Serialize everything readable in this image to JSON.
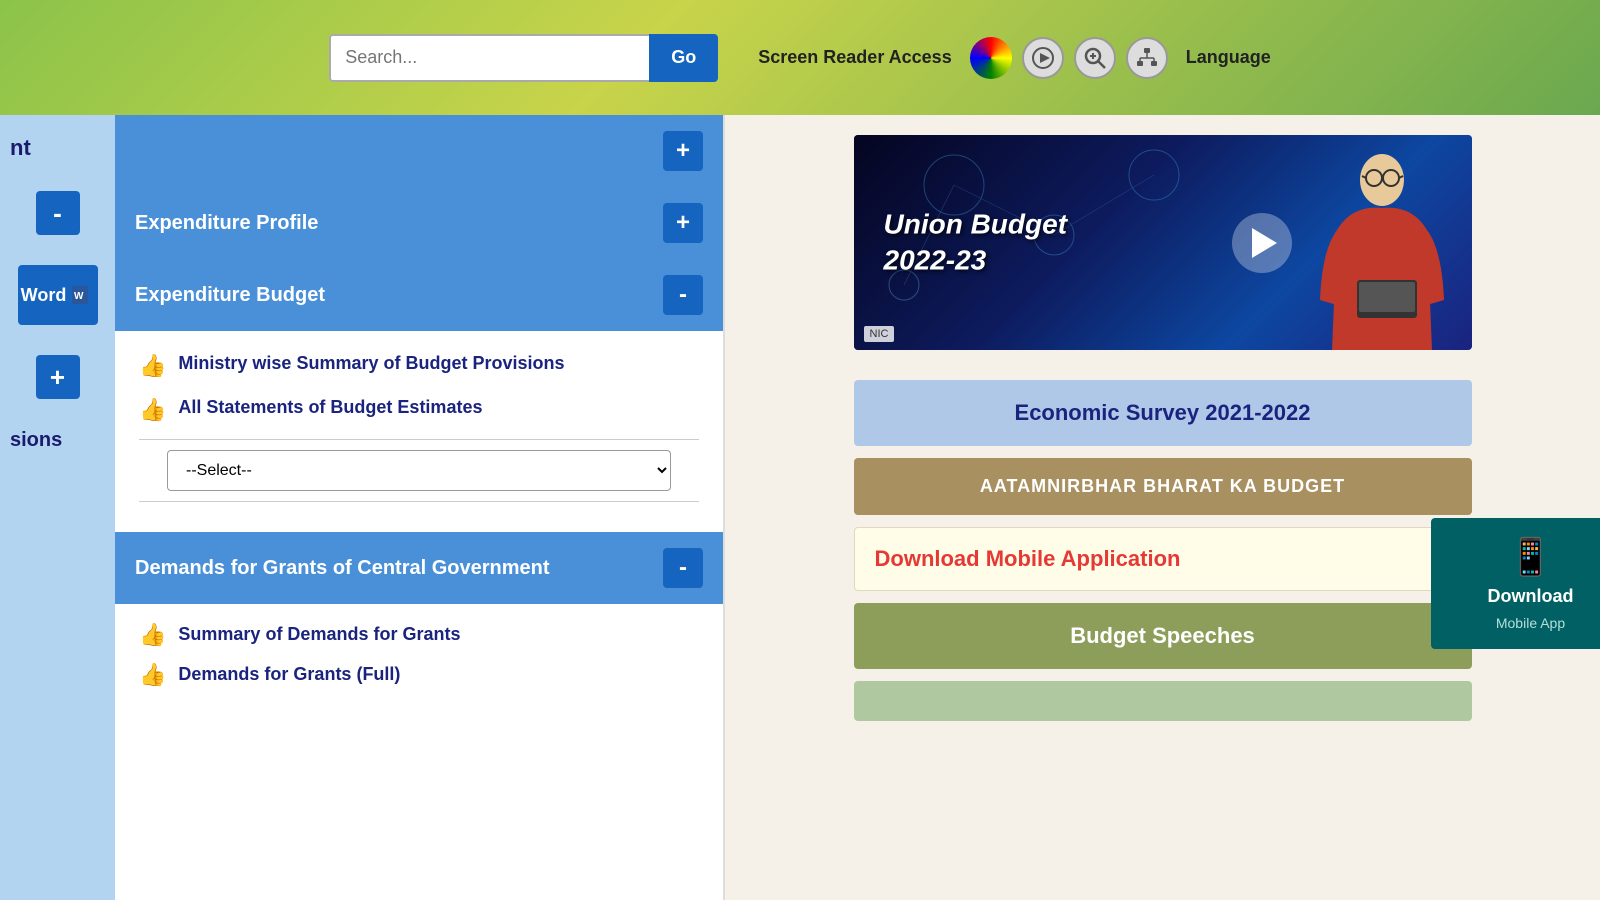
{
  "topbar": {
    "search_placeholder": "Search...",
    "search_btn_label": "Go",
    "screen_reader_label": "Screen Reader Access",
    "language_label": "Language"
  },
  "left_sidebar": {
    "top_label": "nt",
    "minus_btn": "-",
    "word_label": "Word",
    "plus_btn": "+",
    "bottom_label": "sions"
  },
  "main_left": {
    "partial_section": {
      "title": "",
      "toggle": "+"
    },
    "expenditure_profile": {
      "title": "Expenditure Profile",
      "toggle": "+"
    },
    "expenditure_budget": {
      "title": "Expenditure Budget",
      "toggle": "-",
      "items": [
        {
          "icon": "👍",
          "text": "Ministry wise Summary of Budget Provisions"
        },
        {
          "icon": "👍",
          "text": "All Statements of Budget Estimates"
        }
      ],
      "select_default": "--Select--",
      "select_options": [
        "--Select--"
      ]
    },
    "demands_section": {
      "title": "Demands for Grants of Central Government",
      "toggle": "-",
      "items": [
        {
          "icon": "👍",
          "text": "Summary of Demands for Grants"
        },
        {
          "icon": "👍",
          "text": "Demands for Grants (Full)"
        }
      ]
    }
  },
  "main_right": {
    "video": {
      "title_line1": "Union Budget",
      "title_line2": "2022-23",
      "nic_label": "NIC"
    },
    "cards": [
      {
        "id": "economic-survey",
        "text": "Economic Survey 2021-2022",
        "bg": "#b0c8e8",
        "color": "#1a237e"
      },
      {
        "id": "aatma",
        "text": "AATAMNIRBHAR BHARAT KA BUDGET",
        "bg": "#a89060",
        "color": "white"
      },
      {
        "id": "download-mobile",
        "text": "Download Mobile Application",
        "bg": "#fffde7",
        "color": "#e53935"
      },
      {
        "id": "budget-speeches",
        "text": "Budget Speeches",
        "bg": "#8d9e5a",
        "color": "white"
      }
    ],
    "download_popup": {
      "icon": "📱",
      "label": "Download",
      "sublabel": "Mobile App"
    }
  }
}
